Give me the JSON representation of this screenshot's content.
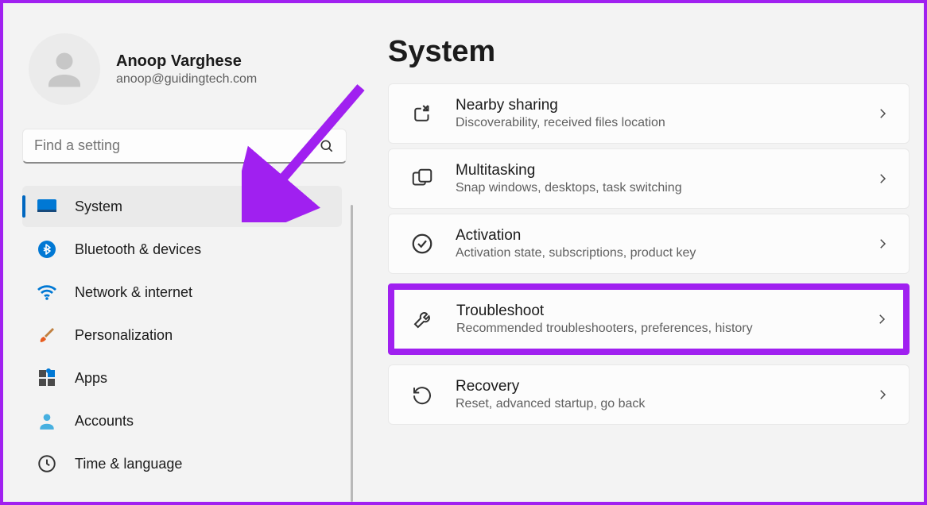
{
  "profile": {
    "name": "Anoop Varghese",
    "email": "anoop@guidingtech.com"
  },
  "search": {
    "placeholder": "Find a setting"
  },
  "page_title": "System",
  "nav": [
    {
      "label": "System",
      "icon": "system",
      "active": true
    },
    {
      "label": "Bluetooth & devices",
      "icon": "bluetooth",
      "active": false
    },
    {
      "label": "Network & internet",
      "icon": "wifi",
      "active": false
    },
    {
      "label": "Personalization",
      "icon": "brush",
      "active": false
    },
    {
      "label": "Apps",
      "icon": "apps",
      "active": false
    },
    {
      "label": "Accounts",
      "icon": "account",
      "active": false
    },
    {
      "label": "Time & language",
      "icon": "clock",
      "active": false
    }
  ],
  "settings": [
    {
      "title": "Nearby sharing",
      "desc": "Discoverability, received files location",
      "icon": "share",
      "highlight": false
    },
    {
      "title": "Multitasking",
      "desc": "Snap windows, desktops, task switching",
      "icon": "multitask",
      "highlight": false
    },
    {
      "title": "Activation",
      "desc": "Activation state, subscriptions, product key",
      "icon": "check",
      "highlight": false
    },
    {
      "title": "Troubleshoot",
      "desc": "Recommended troubleshooters, preferences, history",
      "icon": "wrench",
      "highlight": true
    },
    {
      "title": "Recovery",
      "desc": "Reset, advanced startup, go back",
      "icon": "recovery",
      "highlight": false
    }
  ]
}
